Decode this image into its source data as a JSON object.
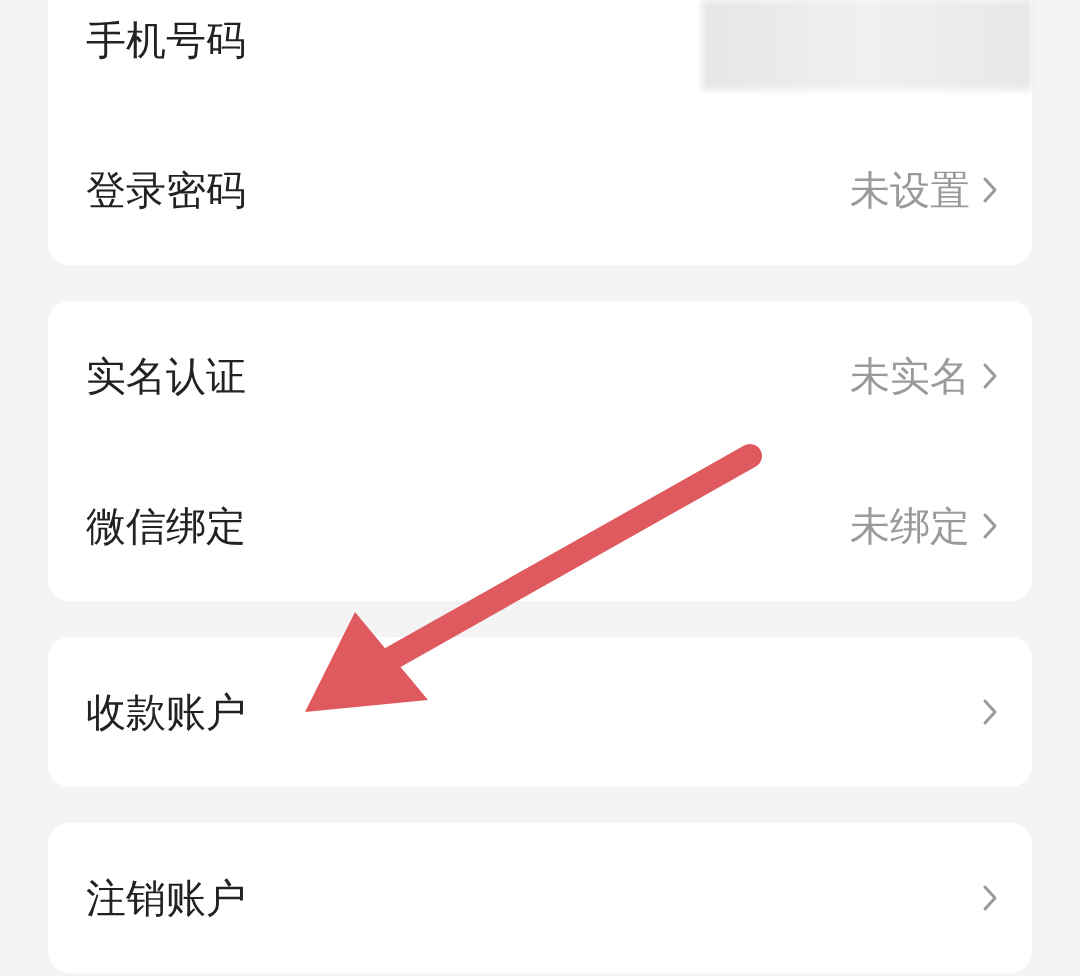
{
  "groups": [
    {
      "rows": [
        {
          "kind": "redacted",
          "label": "手机号码"
        },
        {
          "kind": "link",
          "label": "登录密码",
          "value": "未设置"
        }
      ]
    },
    {
      "rows": [
        {
          "kind": "link",
          "label": "实名认证",
          "value": "未实名"
        },
        {
          "kind": "link",
          "label": "微信绑定",
          "value": "未绑定"
        }
      ]
    },
    {
      "rows": [
        {
          "kind": "link",
          "label": "收款账户"
        }
      ]
    },
    {
      "rows": [
        {
          "kind": "link",
          "label": "注销账户"
        }
      ]
    }
  ]
}
